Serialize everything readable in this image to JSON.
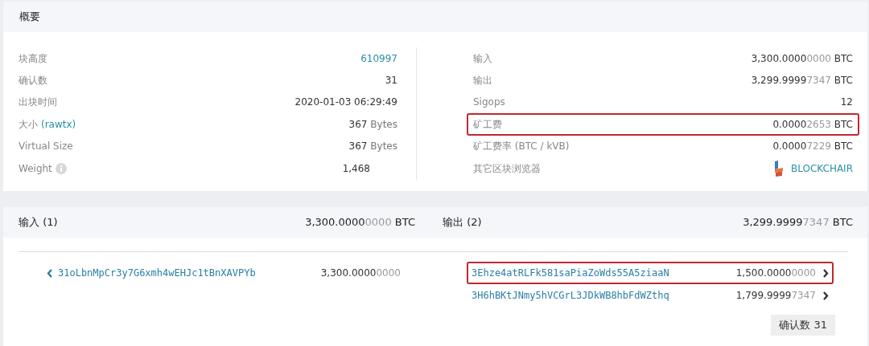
{
  "summary": {
    "title": "概要",
    "left_rows": [
      {
        "kind": "link",
        "label": "块高度",
        "value": "610997"
      },
      {
        "kind": "text",
        "label": "确认数",
        "value": "31"
      },
      {
        "kind": "text",
        "label": "出块时间",
        "value": "2020-01-03 06:29:49"
      },
      {
        "kind": "bytes",
        "label": "大小",
        "label_link": "(rawtx)",
        "value": "367",
        "unit": "Bytes"
      },
      {
        "kind": "bytes",
        "label": "Virtual Size",
        "value": "367",
        "unit": "Bytes"
      },
      {
        "kind": "info",
        "label": "Weight",
        "value": "1,468"
      }
    ],
    "right_rows": [
      {
        "kind": "amount",
        "label": "输入",
        "value_main": "3,300.0000",
        "value_dim": "0000",
        "unit": "BTC",
        "highlighted": false
      },
      {
        "kind": "amount",
        "label": "输出",
        "value_main": "3,299.9999",
        "value_dim": "7347",
        "unit": "BTC",
        "highlighted": false
      },
      {
        "kind": "text",
        "label": "Sigops",
        "value": "12",
        "highlighted": false
      },
      {
        "kind": "amount",
        "label": "矿工费",
        "value_main": "0.0000",
        "value_dim": "2653",
        "unit": "BTC",
        "highlighted": true
      },
      {
        "kind": "amount",
        "label": "矿工费率 (BTC / kVB)",
        "value_main": "0.0000",
        "value_dim": "7229",
        "unit": "BTC",
        "highlighted": false
      },
      {
        "kind": "explorer",
        "label": "其它区块浏览器",
        "value": "BLOCKCHAIR",
        "highlighted": false
      }
    ]
  },
  "io": {
    "inputs": {
      "title": "输入 (1)",
      "total_main": "3,300.0000",
      "total_dim": "0000",
      "unit": "BTC",
      "items": [
        {
          "address": "31oLbnMpCr3y7G6xmh4wEHJc1tBnXAVPYb",
          "value_main": "3,300.0000",
          "value_dim": "0000"
        }
      ]
    },
    "outputs": {
      "title": "输出 (2)",
      "total_main": "3,299.9999",
      "total_dim": "7347",
      "unit": "BTC",
      "items": [
        {
          "address": "3Ehze4atRLFk581saPiaZoWds55A5ziaaN",
          "value_main": "1,500.0000",
          "value_dim": "0000",
          "highlighted": true
        },
        {
          "address": "3H6hBKtJNmy5hVCGrL3JDkWB8hbFdWZthq",
          "value_main": "1,799.9999",
          "value_dim": "7347",
          "highlighted": false
        }
      ]
    },
    "confirmations": "确认数 31"
  }
}
